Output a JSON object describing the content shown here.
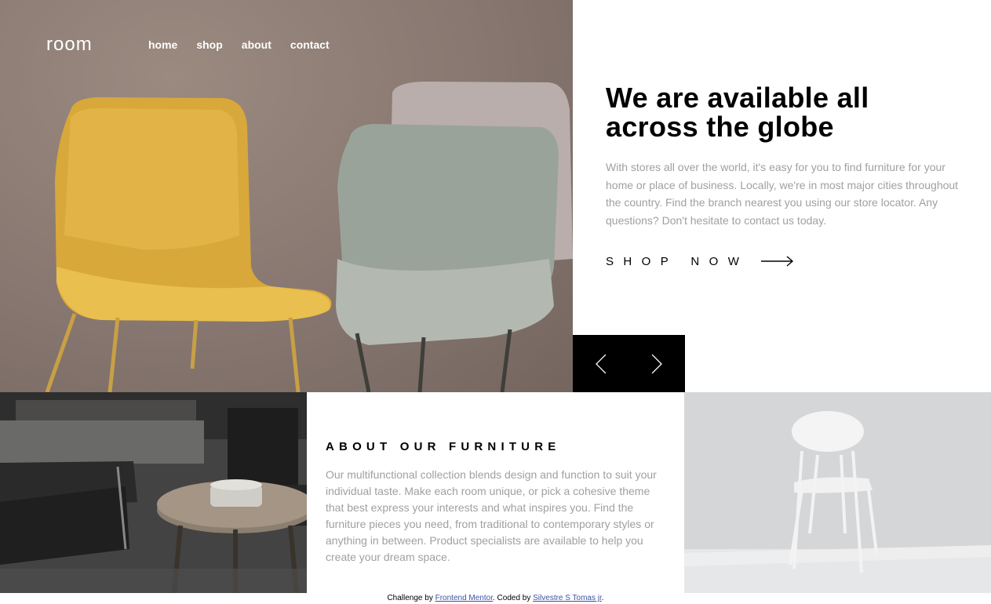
{
  "nav": {
    "logo": "room",
    "links": [
      {
        "label": "home"
      },
      {
        "label": "shop"
      },
      {
        "label": "about"
      },
      {
        "label": "contact"
      }
    ]
  },
  "hero": {
    "title": "We are available all across the globe",
    "description": "With stores all over the world, it's easy for you to find furniture for your home or place of business. Locally, we're in most major cities throughout the country. Find the branch nearest you using our store locator. Any questions? Don't hesitate to contact us today.",
    "cta_label": "SHOP NOW",
    "cta_icon": "arrow-right-icon",
    "image_subject": "yellow and grey chairs"
  },
  "slider": {
    "prev_icon": "chevron-left-icon",
    "next_icon": "chevron-right-icon"
  },
  "about": {
    "title": "ABOUT OUR FURNITURE",
    "description": "Our multifunctional collection blends design and function to suit your individual taste. Make each room unique, or pick a cohesive theme that best express your interests and what inspires you. Find the furniture pieces you need, from traditional to contemporary styles or anything in between. Product specialists are available to help you create your dream space."
  },
  "attribution": {
    "prefix": "Challenge by ",
    "link1": "Frontend Mentor",
    "middle": ". Coded by ",
    "link2": "Silvestre S Tomas jr",
    "suffix": "."
  },
  "colors": {
    "text_primary": "#000000",
    "text_muted": "#a0a0a0",
    "link": "#3e52a3",
    "controls_bg": "#000000"
  }
}
